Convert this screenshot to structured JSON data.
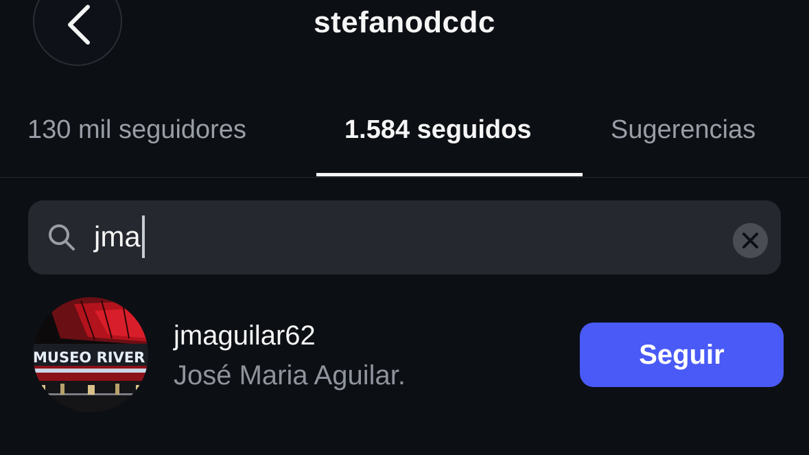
{
  "header": {
    "title": "stefanodcdc"
  },
  "tabs": [
    {
      "label": "130 mil seguidores",
      "active": false
    },
    {
      "label": "1.584 seguidos",
      "active": true
    },
    {
      "label": "Sugerencias",
      "active": false
    }
  ],
  "search": {
    "value": "jma"
  },
  "results": [
    {
      "username": "jmaguilar62",
      "full_name": "José Maria Aguilar.",
      "follow_label": "Seguir",
      "avatar_text": "MUSEO RIVER"
    }
  ],
  "colors": {
    "background": "#0c0f14",
    "accent": "#4a5af6",
    "search_bg": "#25282e"
  },
  "icons": {
    "back": "chevron-left-icon",
    "search": "search-icon",
    "clear": "close-icon"
  }
}
